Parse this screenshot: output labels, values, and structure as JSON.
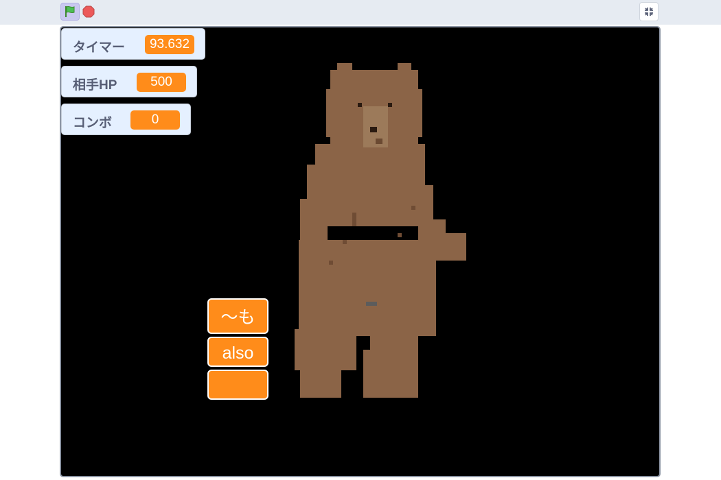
{
  "toolbar": {
    "green_flag_icon": "green-flag-icon",
    "stop_icon": "stop-icon",
    "fullscreen_icon": "exit-fullscreen-icon"
  },
  "monitors": [
    {
      "label": "タイマー",
      "value": "93.632"
    },
    {
      "label": "相手HP",
      "value": "500"
    },
    {
      "label": "コンボ",
      "value": "0"
    }
  ],
  "choices": [
    {
      "label": "〜も"
    },
    {
      "label": "also"
    },
    {
      "label": ""
    }
  ],
  "colors": {
    "accent": "#ff8c1a",
    "stage_background": "#000000",
    "monitor_background": "#e5f0ff",
    "bear": "#8b6447"
  }
}
